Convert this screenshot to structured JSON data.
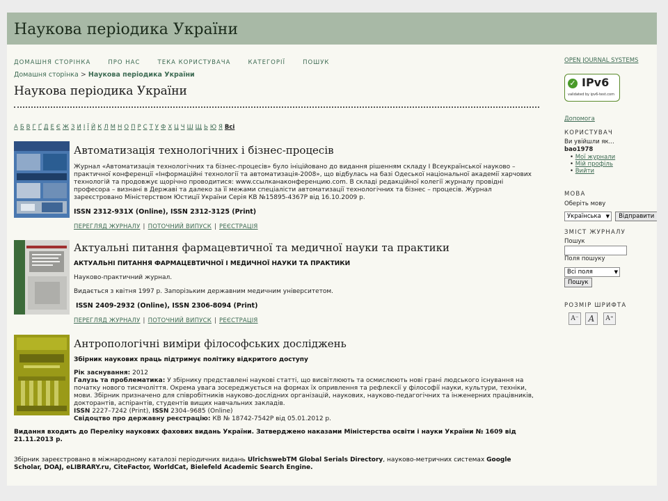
{
  "site_title": "Наукова періодика України",
  "nav": [
    "ДОМАШНЯ СТОРІНКА",
    "ПРО НАС",
    "ТЕКА КОРИСТУВАЧА",
    "КАТЕГОРІЇ",
    "ПОШУК"
  ],
  "breadcrumb": {
    "home": "Домашня сторінка",
    "separator": ">",
    "current": "Наукова періодика України"
  },
  "page_title": "Наукова періодика України",
  "alphabet": [
    "А",
    "Б",
    "В",
    "Г",
    "Ґ",
    "Д",
    "Е",
    "Є",
    "Ж",
    "З",
    "И",
    "І",
    "Ї",
    "Й",
    "К",
    "Л",
    "М",
    "Н",
    "О",
    "П",
    "Р",
    "С",
    "Т",
    "У",
    "Ф",
    "Х",
    "Ц",
    "Ч",
    "Ш",
    "Щ",
    "Ь",
    "Ю",
    "Я"
  ],
  "alphabet_all": "Всі",
  "journals": [
    {
      "title": "Автоматизація технологічних і бізнес-процесів",
      "description": "Журнал «Автоматизація технологічних та бізнес-процесів» було ініційовано до видання рішенням складу І Всеукраїнської науково – практичної конференції «Інформаційні технології та автоматизація-2008», що відбулась на базі Одеської національної академії харчових технологій та продовжує щорічно проводитися: www.ссылканаконференцию.com. В складі редакційної колегії журналу провідні професора – визнані в Державі та далеко за її межами спеціалісти автоматизації технологічних та бізнес – процесів. Журнал зареєстровано Міністерством Юстиції України Серія КВ №15895-4367Р від 16.10.2009 р.",
      "issn": "ISSN 2312-931X (Online), ISSN 2312-3125 (Print)",
      "links": [
        "ПЕРЕГЛЯД ЖУРНАЛУ",
        "ПОТОЧНИЙ ВИПУСК",
        "РЕЄСТРАЦІЯ"
      ]
    },
    {
      "title": "Актуальні питання фармацевтичної та медичної науки та практики",
      "subtitle": "АКТУАЛЬНІ ПИТАННЯ ФАРМАЦЕВТИЧНОЇ І МЕДИЧНОЇ НАУКИ ТА ПРАКТИКИ",
      "line1": "Науково-практичний журнал.",
      "line2": "Видається з квітня 1997 р. Запорізьким державним медичним університетом.",
      "issn": "ISSN 2409-2932 (Online), ISSN 2306-8094 (Print)",
      "links": [
        "ПЕРЕГЛЯД ЖУРНАЛУ",
        "ПОТОЧНИЙ ВИПУСК",
        "РЕЄСТРАЦІЯ"
      ]
    },
    {
      "title": "Антропологічні виміри філософських досліджень",
      "subtitle": "Збірник наукових праць підтримує політику відкритого доступу",
      "founded_label": "Рік заснування:",
      "founded_value": "2012",
      "field_label": "Галузь та проблематика:",
      "field_value": "У збірнику представлені наукові статті, що висвітлюють та осмислюють нові грані людського існування на початку нового тисячоліття. Окрема увага зосереджується на формах їх опривлення та рефлексії у філософії науки, культури, техніки, мови. Збірник призначено для співробітників науково-дослідних організацій, наукових, науково-педагогічних та інженерних працівників, докторантів, аспірантів, студентів вищих навчальних закладів.",
      "issn_label1": "ISSN",
      "issn_value1": "2227–7242 (Print),",
      "issn_label2": "ISSN",
      "issn_value2": "2304–9685 (Online)",
      "cert_label": "Свідоцтво про державну реєстрацію:",
      "cert_value": "КВ № 18742-7542Р від 05.01.2012 р."
    }
  ],
  "footer_bold": "Видання входить до Переліку наукових фахових видань України. Затверджено наказами Міністерства освіти і науки України  № 1609 від 21.11.2013 р.",
  "footer_reg": {
    "p1": "Збірник зареєстровано в міжнародному каталозі періодичних видань ",
    "b1": "UlrichswebTM Global Serials Directory",
    "p2": ", науково-метричних системах ",
    "b2": "Google Scholar, DOAJ, eLIBRARY.ru, CiteFactor,  WorldCat, Bielefeld Academic Search Engine."
  },
  "sidebar": {
    "ojs": "OPEN JOURNAL SYSTEMS",
    "ipv6_big": "IPv6",
    "ipv6_small": "validated by ipv6-test.com",
    "help": "Допомога",
    "user_heading": "КОРИСТУВАЧ",
    "logged_in_as": "Ви увійшли як...",
    "username": "bao1978",
    "user_links": [
      "Мої журнали",
      "Мій профіль",
      "Вийти"
    ],
    "lang_heading": "МОВА",
    "choose_lang": "Оберіть мову",
    "lang_value": "Українська",
    "lang_submit": "Відправити",
    "content_heading": "ЗМІСТ ЖУРНАЛУ",
    "search_label": "Пошук",
    "search_value": "",
    "field_label": "Поля пошуку",
    "field_value": "Всі поля",
    "search_button": "Пошук",
    "font_heading": "РОЗМІР ШРИФТА"
  }
}
